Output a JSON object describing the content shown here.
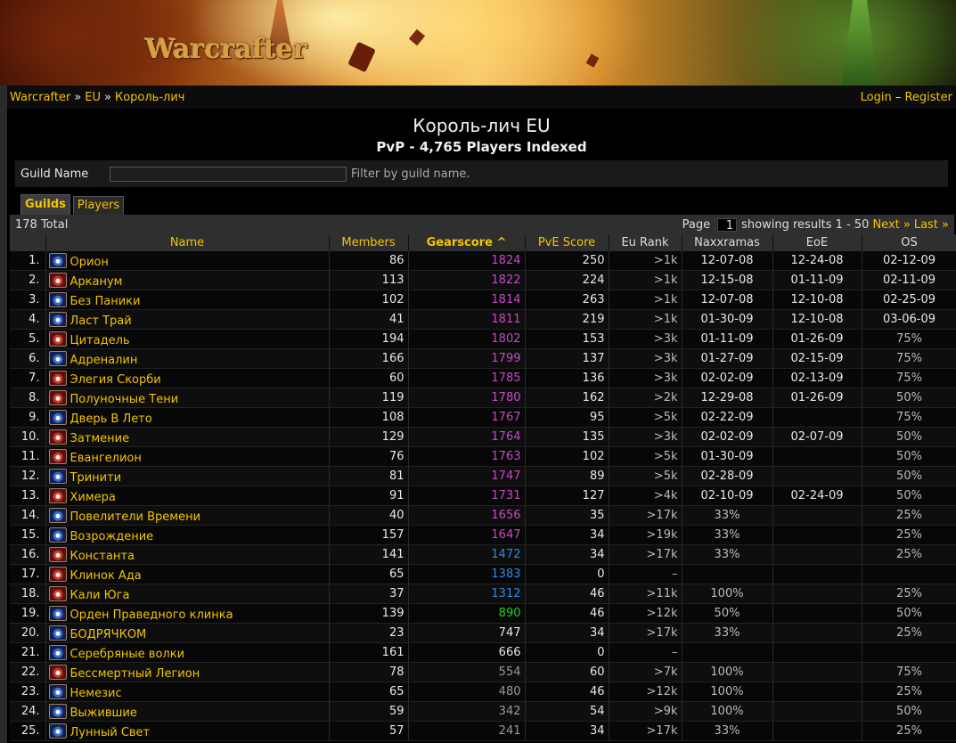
{
  "site": {
    "logo": "Warcrafter"
  },
  "breadcrumb": [
    "Warcrafter",
    "EU",
    "Король-лич"
  ],
  "auth": {
    "login": "Login",
    "dash": "–",
    "register": "Register"
  },
  "title": "Король-лич EU",
  "subtitle": "PvP - 4,765 Players Indexed",
  "filter": {
    "label": "Guild Name",
    "value": "",
    "hint": "Filter by guild name."
  },
  "tabs": [
    "Guilds",
    "Players"
  ],
  "pager": {
    "total": "178 Total",
    "page_label": "Page",
    "page": "1",
    "showing": "showing results 1 - 50",
    "next": "Next »",
    "last": "Last »"
  },
  "columns": [
    "Name",
    "Members",
    "Gearscore ^",
    "PvE Score",
    "Eu Rank",
    "Naxxramas",
    "EoE",
    "OS"
  ],
  "colors": {
    "accent": "#f4c400",
    "gs_purple": "#c84ac8",
    "gs_blue": "#2a8ae8",
    "gs_green": "#1ed01e"
  },
  "rows": [
    {
      "rank": "1.",
      "faction": "a",
      "name": "Орион",
      "members": "86",
      "gs": "1824",
      "gsc": "purple",
      "pve": "250",
      "eu": ">1k",
      "naxx": "12-07-08",
      "eoe": "12-24-08",
      "os": "02-12-09"
    },
    {
      "rank": "2.",
      "faction": "h",
      "name": "Арканум",
      "members": "113",
      "gs": "1822",
      "gsc": "purple",
      "pve": "224",
      "eu": ">1k",
      "naxx": "12-15-08",
      "eoe": "01-11-09",
      "os": "02-11-09"
    },
    {
      "rank": "3.",
      "faction": "a",
      "name": "Без Паники",
      "members": "102",
      "gs": "1814",
      "gsc": "purple",
      "pve": "263",
      "eu": ">1k",
      "naxx": "12-07-08",
      "eoe": "12-10-08",
      "os": "02-25-09"
    },
    {
      "rank": "4.",
      "faction": "a",
      "name": "Ласт Трай",
      "members": "41",
      "gs": "1811",
      "gsc": "purple",
      "pve": "219",
      "eu": ">1k",
      "naxx": "01-30-09",
      "eoe": "12-10-08",
      "os": "03-06-09"
    },
    {
      "rank": "5.",
      "faction": "h",
      "name": "Цитадель",
      "members": "194",
      "gs": "1802",
      "gsc": "purple",
      "pve": "153",
      "eu": ">3k",
      "naxx": "01-11-09",
      "eoe": "01-26-09",
      "os": "75%"
    },
    {
      "rank": "6.",
      "faction": "a",
      "name": "Адреналин",
      "members": "166",
      "gs": "1799",
      "gsc": "purple",
      "pve": "137",
      "eu": ">3k",
      "naxx": "01-27-09",
      "eoe": "02-15-09",
      "os": "75%"
    },
    {
      "rank": "7.",
      "faction": "h",
      "name": "Элегия Скорби",
      "members": "60",
      "gs": "1785",
      "gsc": "purple",
      "pve": "136",
      "eu": ">3k",
      "naxx": "02-02-09",
      "eoe": "02-13-09",
      "os": "75%"
    },
    {
      "rank": "8.",
      "faction": "h",
      "name": "Полуночные Тени",
      "members": "119",
      "gs": "1780",
      "gsc": "purple",
      "pve": "162",
      "eu": ">2k",
      "naxx": "12-29-08",
      "eoe": "01-26-09",
      "os": "50%"
    },
    {
      "rank": "9.",
      "faction": "a",
      "name": "Дверь В Лето",
      "members": "108",
      "gs": "1767",
      "gsc": "purple",
      "pve": "95",
      "eu": ">5k",
      "naxx": "02-22-09",
      "eoe": "",
      "os": "75%"
    },
    {
      "rank": "10.",
      "faction": "h",
      "name": "Затмение",
      "members": "129",
      "gs": "1764",
      "gsc": "purple",
      "pve": "135",
      "eu": ">3k",
      "naxx": "02-02-09",
      "eoe": "02-07-09",
      "os": "50%"
    },
    {
      "rank": "11.",
      "faction": "h",
      "name": "Евангелион",
      "members": "76",
      "gs": "1763",
      "gsc": "purple",
      "pve": "102",
      "eu": ">5k",
      "naxx": "01-30-09",
      "eoe": "",
      "os": "50%"
    },
    {
      "rank": "12.",
      "faction": "a",
      "name": "Тринити",
      "members": "81",
      "gs": "1747",
      "gsc": "purple",
      "pve": "89",
      "eu": ">5k",
      "naxx": "02-28-09",
      "eoe": "",
      "os": "50%"
    },
    {
      "rank": "13.",
      "faction": "h",
      "name": "Химера",
      "members": "91",
      "gs": "1731",
      "gsc": "purple",
      "pve": "127",
      "eu": ">4k",
      "naxx": "02-10-09",
      "eoe": "02-24-09",
      "os": "50%"
    },
    {
      "rank": "14.",
      "faction": "a",
      "name": "Повелители Времени",
      "members": "40",
      "gs": "1656",
      "gsc": "purple",
      "pve": "35",
      "eu": ">17k",
      "naxx": "33%",
      "eoe": "",
      "os": "25%"
    },
    {
      "rank": "15.",
      "faction": "a",
      "name": "Возрождение",
      "members": "157",
      "gs": "1647",
      "gsc": "purple",
      "pve": "34",
      "eu": ">19k",
      "naxx": "33%",
      "eoe": "",
      "os": "25%"
    },
    {
      "rank": "16.",
      "faction": "h",
      "name": "Константа",
      "members": "141",
      "gs": "1472",
      "gsc": "blue",
      "pve": "34",
      "eu": ">17k",
      "naxx": "33%",
      "eoe": "",
      "os": "25%"
    },
    {
      "rank": "17.",
      "faction": "h",
      "name": "Клинок Ада",
      "members": "65",
      "gs": "1383",
      "gsc": "blue",
      "pve": "0",
      "eu": "–",
      "naxx": "",
      "eoe": "",
      "os": ""
    },
    {
      "rank": "18.",
      "faction": "h",
      "name": "Кали Юга",
      "members": "37",
      "gs": "1312",
      "gsc": "blue",
      "pve": "46",
      "eu": ">11k",
      "naxx": "100%",
      "eoe": "",
      "os": "25%"
    },
    {
      "rank": "19.",
      "faction": "a",
      "name": "Орден Праведного клинка",
      "members": "139",
      "gs": "890",
      "gsc": "green",
      "pve": "46",
      "eu": ">12k",
      "naxx": "50%",
      "eoe": "",
      "os": "50%"
    },
    {
      "rank": "20.",
      "faction": "a",
      "name": "БОДРЯЧКОМ",
      "members": "23",
      "gs": "747",
      "gsc": "white",
      "pve": "34",
      "eu": ">17k",
      "naxx": "33%",
      "eoe": "",
      "os": "25%"
    },
    {
      "rank": "21.",
      "faction": "a",
      "name": "Серебряные волки",
      "members": "161",
      "gs": "666",
      "gsc": "white",
      "pve": "0",
      "eu": "–",
      "naxx": "",
      "eoe": "",
      "os": ""
    },
    {
      "rank": "22.",
      "faction": "h",
      "name": "Бессмертный Легион",
      "members": "78",
      "gs": "554",
      "gsc": "grey",
      "pve": "60",
      "eu": ">7k",
      "naxx": "100%",
      "eoe": "",
      "os": "75%"
    },
    {
      "rank": "23.",
      "faction": "a",
      "name": "Немезис",
      "members": "65",
      "gs": "480",
      "gsc": "grey",
      "pve": "46",
      "eu": ">12k",
      "naxx": "100%",
      "eoe": "",
      "os": "25%"
    },
    {
      "rank": "24.",
      "faction": "a",
      "name": "Выжившие",
      "members": "59",
      "gs": "342",
      "gsc": "grey",
      "pve": "54",
      "eu": ">9k",
      "naxx": "100%",
      "eoe": "",
      "os": "50%"
    },
    {
      "rank": "25.",
      "faction": "a",
      "name": "Лунный Свет",
      "members": "57",
      "gs": "241",
      "gsc": "grey",
      "pve": "34",
      "eu": ">17k",
      "naxx": "33%",
      "eoe": "",
      "os": "25%"
    }
  ]
}
